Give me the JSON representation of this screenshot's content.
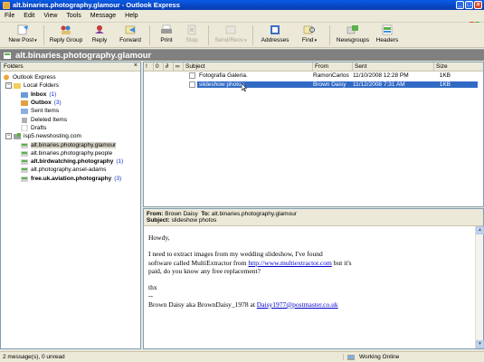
{
  "window": {
    "title": "alt.binaries.photography.glamour - Outlook Express"
  },
  "menu": [
    "File",
    "Edit",
    "View",
    "Tools",
    "Message",
    "Help"
  ],
  "toolbar": {
    "new_post": "New Post",
    "reply_group": "Reply Group",
    "reply": "Reply",
    "forward": "Forward",
    "print": "Print",
    "stop": "Stop",
    "send_recv": "Send/Recv",
    "addresses": "Addresses",
    "find": "Find",
    "newsgroups": "Newsgroups",
    "headers": "Headers"
  },
  "banner": {
    "title": "alt.binaries.photography.glamour"
  },
  "folders": {
    "header": "Folders",
    "close": "×",
    "items": [
      {
        "label": "Outlook Express",
        "count": ""
      },
      {
        "label": "Local Folders",
        "count": ""
      },
      {
        "label": "Inbox",
        "count": "(1)"
      },
      {
        "label": "Outbox",
        "count": "(3)"
      },
      {
        "label": "Sent Items",
        "count": ""
      },
      {
        "label": "Deleted Items",
        "count": ""
      },
      {
        "label": "Drafts",
        "count": ""
      },
      {
        "label": "isp5.newshosting.com",
        "count": ""
      },
      {
        "label": "alt.binaries.photography.glamour",
        "count": ""
      },
      {
        "label": "alt.binaries.photography.people",
        "count": ""
      },
      {
        "label": "alt.birdwatching.photography",
        "count": "(1)"
      },
      {
        "label": "alt.photography.ansel-adams",
        "count": ""
      },
      {
        "label": "free.uk.aviation.photography",
        "count": "(3)"
      }
    ]
  },
  "messages": {
    "columns": {
      "subject": "Subject",
      "from": "From",
      "sent": "Sent",
      "size": "Size"
    },
    "rows": [
      {
        "subject": "Fotografia Galeria.",
        "from": "RamonCarlos",
        "sent": "11/10/2008 12:28 PM",
        "size": "1KB"
      },
      {
        "subject": "slideshow photos",
        "from": "Brown Daisy",
        "sent": "11/12/2008 7:31 AM",
        "size": "1KB"
      }
    ]
  },
  "preview": {
    "from_label": "From:",
    "from": "Brown Daisy",
    "to_label": "To:",
    "to": "alt.binaries.photography.glamour",
    "subject_label": "Subject:",
    "subject": "slideshow photos",
    "greeting": "Howdy,",
    "body_1": "I need to extract images from my wedding slideshow, I've found",
    "body_2a": "software called MultiExtractor from ",
    "body_link": "http://www.multiextractor.com",
    "body_2b": " but it's",
    "body_3": "paid, do you know any free replacement?",
    "thx": "thx",
    "sig_dash": "--",
    "sig_text": "Brown Daisy aka BrownDaisy_1978 at ",
    "sig_email": "Daisy1977@postmaster.co.uk"
  },
  "status": {
    "left": "2 message(s), 0 unread",
    "right": "Working Online"
  }
}
